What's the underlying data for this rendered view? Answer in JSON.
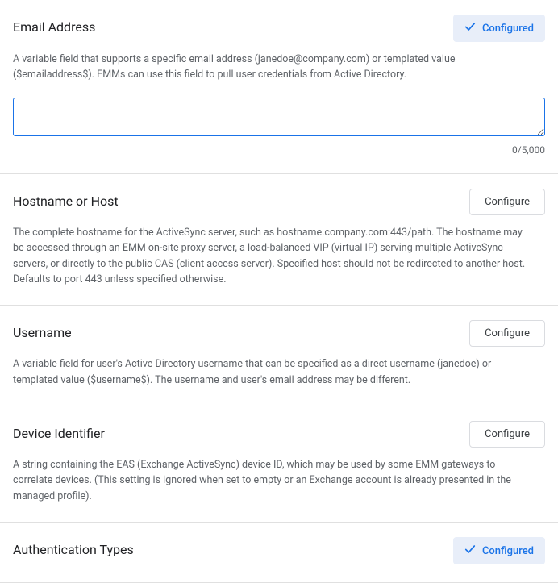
{
  "labels": {
    "configured": "Configured",
    "configure": "Configure"
  },
  "sections": {
    "email": {
      "title": "Email Address",
      "desc": "A variable field that supports a specific email address (janedoe@company.com) or templated value ($emailaddress$). EMMs can use this field to pull user credentials from Active Directory.",
      "value": "",
      "counter": "0/5,000"
    },
    "hostname": {
      "title": "Hostname or Host",
      "desc": "The complete hostname for the ActiveSync server, such as hostname.company.com:443/path. The hostname may be accessed through an EMM on-site proxy server, a load-balanced VIP (virtual IP) serving multiple ActiveSync servers, or directly to the public CAS (client access server). Specified host should not be redirected to another host. Defaults to port 443 unless specified otherwise."
    },
    "username": {
      "title": "Username",
      "desc": "A variable field for user's Active Directory username that can be specified as a direct username (janedoe) or templated value ($username$). The username and user's email address may be different."
    },
    "device": {
      "title": "Device Identifier",
      "desc": "A string containing the EAS (Exchange ActiveSync) device ID, which may be used by some EMM gateways to correlate devices. (This setting is ignored when set to empty or an Exchange account is already presented in the managed profile)."
    },
    "auth": {
      "title": "Authentication Types"
    }
  }
}
